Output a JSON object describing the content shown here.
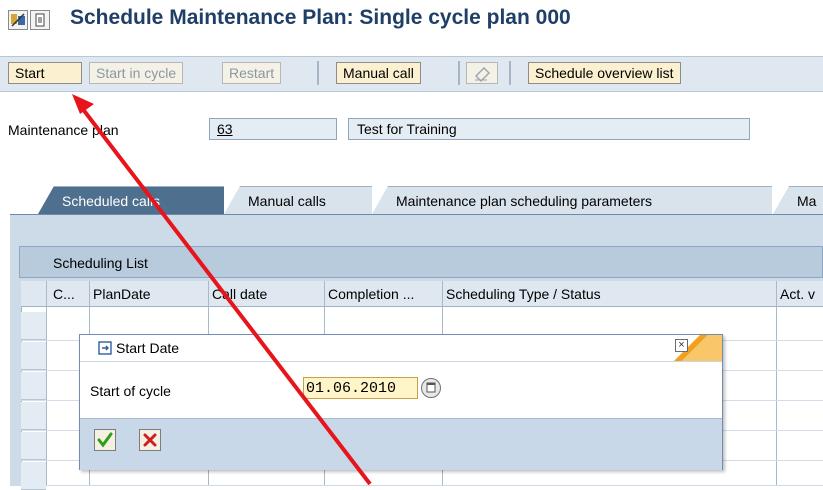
{
  "window": {
    "title": "Schedule Maintenance Plan: Single cycle plan 000"
  },
  "toolbar": {
    "start": "Start",
    "start_in_cycle": "Start in cycle",
    "restart": "Restart",
    "manual_call": "Manual call",
    "schedule_overview_list": "Schedule overview list"
  },
  "header": {
    "maintenance_plan_label": "Maintenance plan",
    "maintenance_plan_value": "63",
    "maintenance_plan_description": "Test for Training"
  },
  "tabs": [
    {
      "label": "Scheduled calls",
      "active": true
    },
    {
      "label": "Manual calls",
      "active": false
    },
    {
      "label": "Maintenance plan scheduling parameters",
      "active": false
    },
    {
      "label": "Ma",
      "active": false
    }
  ],
  "scheduling_list": {
    "title": "Scheduling List",
    "columns": [
      "C...",
      "PlanDate",
      "Call date",
      "Completion ...",
      "Scheduling Type / Status",
      "Act. v"
    ]
  },
  "dialog": {
    "title": "Start Date",
    "start_of_cycle_label": "Start of cycle",
    "start_of_cycle_value": "01.06.2010"
  },
  "colors": {
    "accent": "#1f3f67",
    "annotation_arrow": "#e8141b",
    "dialog_accent": "#f0a01e"
  }
}
